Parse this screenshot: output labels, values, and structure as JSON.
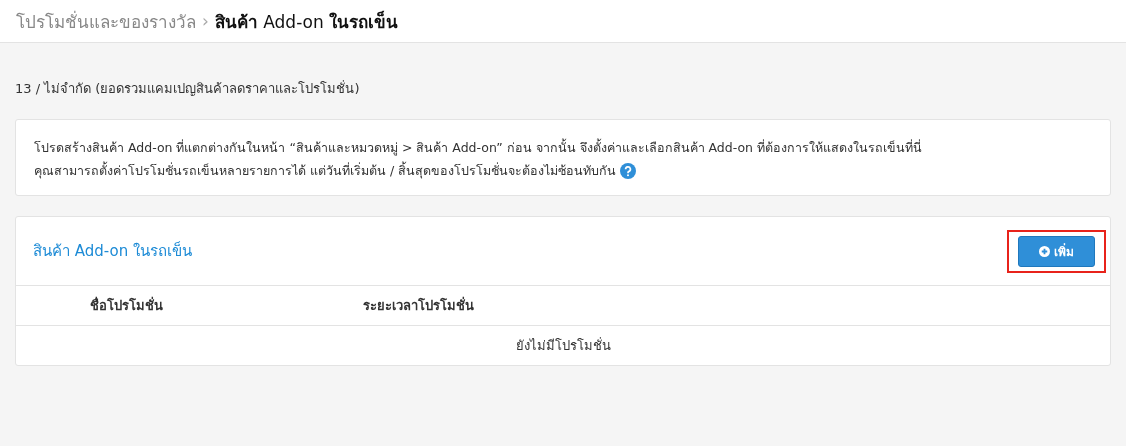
{
  "breadcrumb": {
    "parent": "โปรโมชั่นและของรางวัล",
    "separator": "›",
    "current": "**สินค้า** Add-on **ในรถเข็น**"
  },
  "quota": "13 / ไม่จำกัด (ยอดรวมแคมเปญสินค้าลดราคาและโปรโมชั่น)",
  "notice": {
    "lines": [
      "โปรดสร้างสินค้า Add-on ที่แตกต่างกันในหน้า “สินค้าและหมวดหมู่ > สินค้า Add-on” ก่อน จากนั้น จึงตั้งค่าและเลือกสินค้า Add-on ที่ต้องการให้แสดงในรถเข็นที่นี่",
      "คุณสามารถตั้งค่าโปรโมชั่นรถเข็นหลายรายการได้ แต่วันที่เริ่มต้น / สิ้นสุดของโปรโมชั่นจะต้องไม่ซ้อนทับกัน"
    ]
  },
  "panel": {
    "title": "สินค้า Add-on ในรถเข็น",
    "add_button": {
      "label": "เพิ่ม",
      "highlighted": true
    },
    "table": {
      "columns": [
        "ชื่อโปรโมชั่น",
        "ระยะเวลาโปรโมชั่น"
      ],
      "empty_message": "ยังไม่มีโปรโมชั่น"
    }
  }
}
